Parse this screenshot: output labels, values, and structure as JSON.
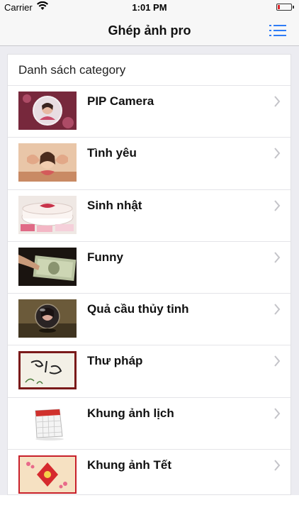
{
  "status": {
    "carrier": "Carrier",
    "time": "1:01 PM",
    "battery_level": 0.15,
    "battery_color": "#e0262a"
  },
  "nav": {
    "title": "Ghép ảnh pro",
    "menu_icon": "list-menu-icon",
    "accent": "#2f7cf6"
  },
  "list": {
    "header": "Danh sách category",
    "items": [
      {
        "label": "PIP Camera",
        "thumb": "pip-camera-thumbnail"
      },
      {
        "label": "Tình yêu",
        "thumb": "love-thumbnail"
      },
      {
        "label": "Sinh nhật",
        "thumb": "birthday-thumbnail"
      },
      {
        "label": "Funny",
        "thumb": "funny-thumbnail"
      },
      {
        "label": "Quả cầu thủy tinh",
        "thumb": "crystal-ball-thumbnail"
      },
      {
        "label": "Thư pháp",
        "thumb": "calligraphy-thumbnail"
      },
      {
        "label": "Khung ảnh lịch",
        "thumb": "calendar-thumbnail"
      },
      {
        "label": "Khung ảnh Tết",
        "thumb": "tet-thumbnail"
      }
    ]
  }
}
